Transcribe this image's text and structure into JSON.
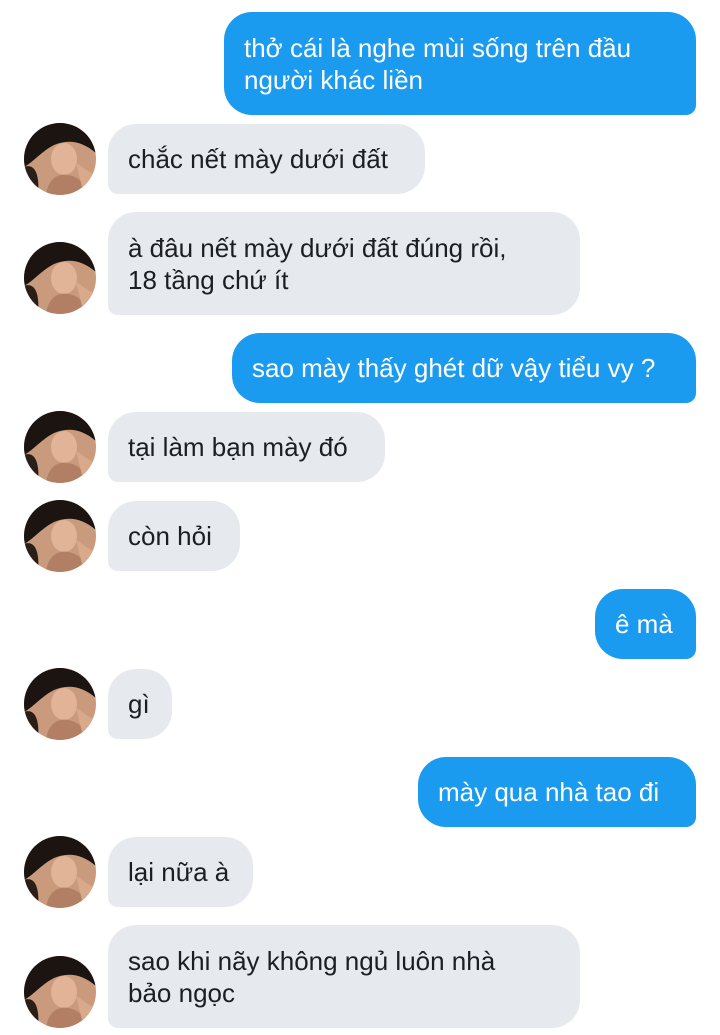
{
  "messages": [
    {
      "side": "out",
      "text": "thở cái là nghe mùi sống trên đầu\nngười khác liền"
    },
    {
      "side": "in",
      "text": "chắc nết mày dưới đất"
    },
    {
      "side": "in",
      "text": "à đâu nết mày dưới đất đúng rồi,\n18 tầng chứ ít"
    },
    {
      "side": "out",
      "text": "sao mày thấy ghét dữ vậy tiểu vy ?"
    },
    {
      "side": "in",
      "text": "tại làm bạn mày đó"
    },
    {
      "side": "in",
      "text": "còn hỏi"
    },
    {
      "side": "out",
      "text": "ê mà"
    },
    {
      "side": "in",
      "text": "gì"
    },
    {
      "side": "out",
      "text": "mày qua nhà tao đi"
    },
    {
      "side": "in",
      "text": "lại nữa à"
    },
    {
      "side": "in",
      "text": "sao khi nãy không ngủ luôn nhà\nbảo ngọc"
    }
  ],
  "colors": {
    "outgoing_bubble": "#1a9bf0",
    "incoming_bubble": "#e6e9ee",
    "incoming_text": "#1c1e21",
    "outgoing_text": "#ffffff"
  },
  "icons": {
    "avatar": "contact-avatar-photo"
  }
}
